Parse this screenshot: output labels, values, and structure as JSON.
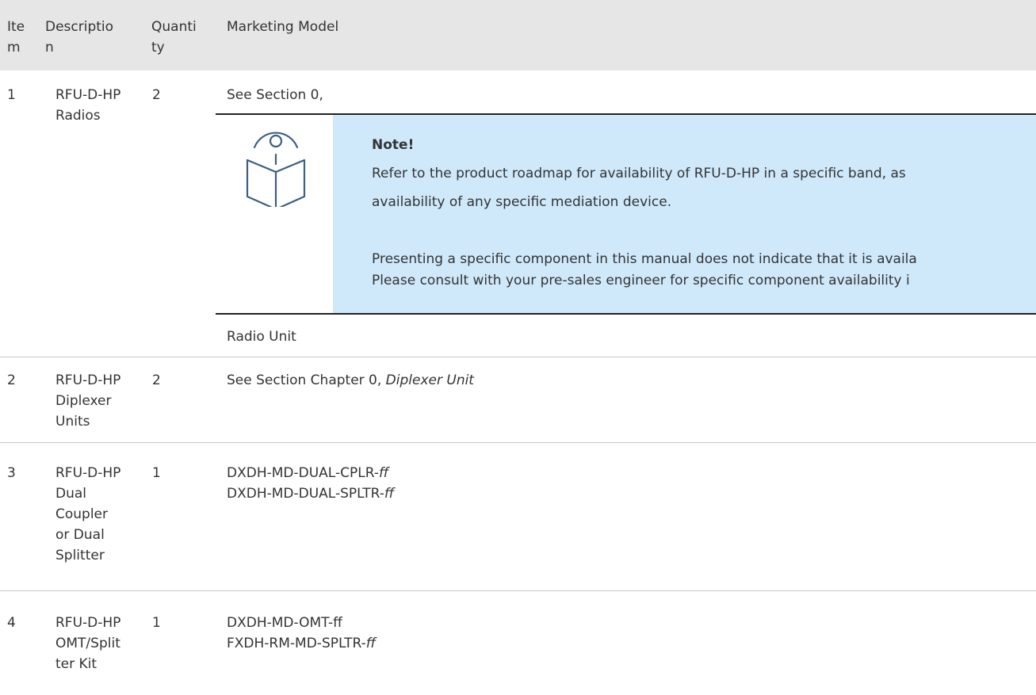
{
  "header": {
    "item": [
      "Ite",
      "m"
    ],
    "description": [
      "Descriptio",
      "n"
    ],
    "quantity": [
      "Quanti",
      "ty"
    ],
    "model": "Marketing Model"
  },
  "rows": [
    {
      "item": "1",
      "description": [
        "RFU-D-HP",
        "Radios"
      ],
      "quantity": "2",
      "model_line": "See Section 0,",
      "note": {
        "icon": "reader-book-icon",
        "title": "Note!",
        "lines": [
          "Refer to the product roadmap for availability of RFU-D-HP in a specific band, as",
          "availability of any specific mediation device.",
          "Presenting a specific component in this manual does not indicate that it is availa",
          "Please consult with your pre-sales engineer for specific component availability i"
        ]
      },
      "model_after": "Radio Unit"
    },
    {
      "item": "2",
      "description": [
        "RFU-D-HP",
        "Diplexer",
        "Units"
      ],
      "quantity": "2",
      "model_prefix": "See Section Chapter 0, ",
      "model_italic": "Diplexer Unit"
    },
    {
      "item": "3",
      "description": [
        "RFU-D-HP",
        "Dual",
        "Coupler",
        "or Dual",
        "Splitter"
      ],
      "quantity": "1",
      "models": [
        {
          "text": "DXDH-MD-DUAL-CPLR-",
          "italic": "ff"
        },
        {
          "text": "DXDH-MD-DUAL-SPLTR-",
          "italic": "ff"
        }
      ]
    },
    {
      "item": "4",
      "description": [
        "RFU-D-HP",
        "OMT/Split",
        "ter Kit"
      ],
      "quantity": "1",
      "models": [
        {
          "text": "DXDH-MD-OMT-ff",
          "italic": ""
        },
        {
          "text": "FXDH-RM-MD-SPLTR-",
          "italic": "ff"
        }
      ]
    }
  ],
  "colors": {
    "header_bg": "#e6e6e6",
    "note_bg": "#cfe9fb",
    "icon_stroke": "#3d5f80",
    "text": "#333333"
  }
}
